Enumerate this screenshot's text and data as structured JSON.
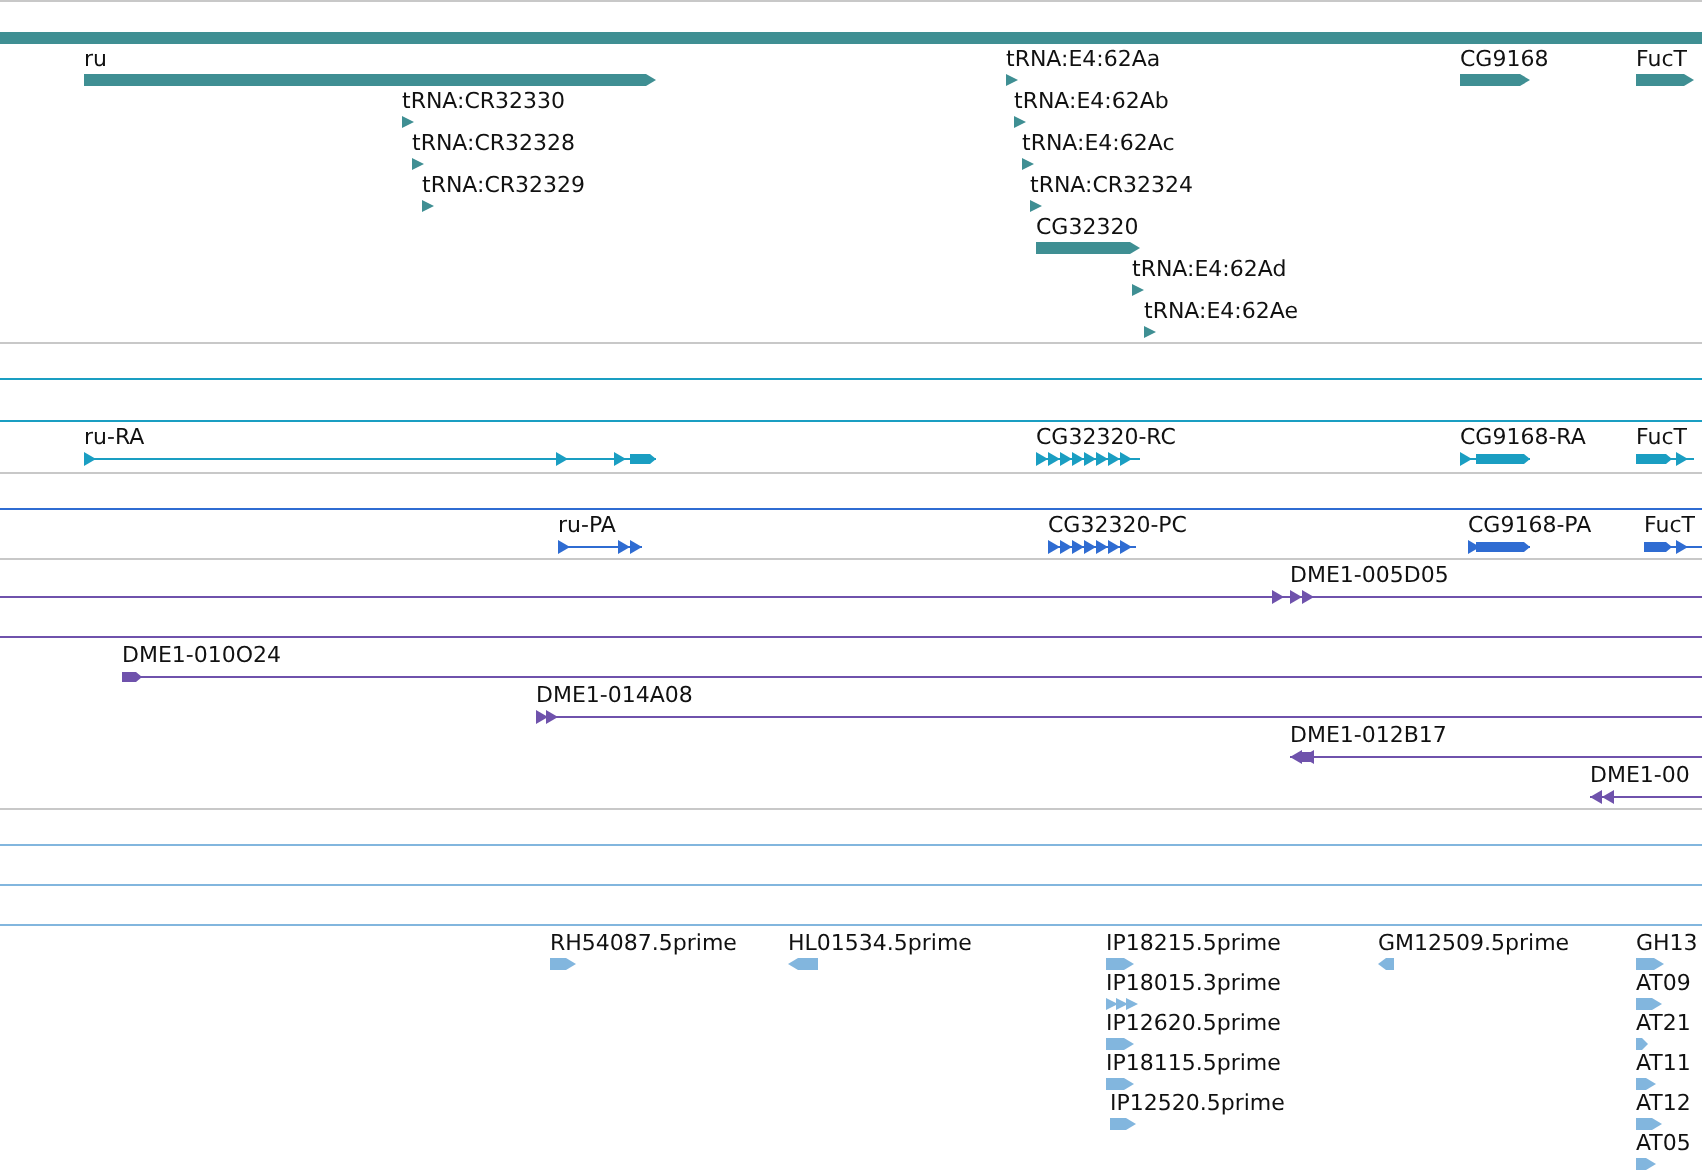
{
  "tracks": [
    {
      "color": "#3f8f93",
      "features": [
        {
          "label": "ru",
          "kind": "gene",
          "reverse": false
        },
        {
          "label": "tRNA:CR32330",
          "kind": "tick",
          "reverse": false
        },
        {
          "label": "tRNA:CR32328",
          "kind": "tick",
          "reverse": false
        },
        {
          "label": "tRNA:CR32329",
          "kind": "tick",
          "reverse": false
        },
        {
          "label": "tRNA:E4:62Aa",
          "kind": "tick",
          "reverse": false
        },
        {
          "label": "tRNA:E4:62Ab",
          "kind": "tick",
          "reverse": false
        },
        {
          "label": "tRNA:E4:62Ac",
          "kind": "tick",
          "reverse": false
        },
        {
          "label": "tRNA:CR32324",
          "kind": "tick",
          "reverse": false
        },
        {
          "label": "CG32320",
          "kind": "gene",
          "reverse": false
        },
        {
          "label": "tRNA:E4:62Ad",
          "kind": "tick",
          "reverse": false
        },
        {
          "label": "tRNA:E4:62Ae",
          "kind": "tick",
          "reverse": false
        },
        {
          "label": "CG9168",
          "kind": "gene",
          "reverse": false
        },
        {
          "label": "FucT",
          "kind": "gene",
          "reverse": false
        }
      ]
    },
    {
      "color": "#1a9ec2",
      "features": [
        {
          "label": "ru-RA",
          "kind": "transcript",
          "reverse": false
        },
        {
          "label": "CG32320-RC",
          "kind": "transcript",
          "reverse": false
        },
        {
          "label": "CG9168-RA",
          "kind": "transcript",
          "reverse": false
        },
        {
          "label": "FucT",
          "kind": "transcript",
          "reverse": false
        }
      ]
    },
    {
      "color": "#2f6cd2",
      "features": [
        {
          "label": "ru-PA",
          "kind": "transcript",
          "reverse": false
        },
        {
          "label": "CG32320-PC",
          "kind": "transcript",
          "reverse": false
        },
        {
          "label": "CG9168-PA",
          "kind": "transcript",
          "reverse": false
        },
        {
          "label": "FucT",
          "kind": "transcript",
          "reverse": false
        }
      ]
    },
    {
      "color": "#6f52ac",
      "features": [
        {
          "label": "DME1-005D05",
          "kind": "clone",
          "reverse": false
        },
        {
          "kind": "clone"
        },
        {
          "label": "DME1-010O24",
          "kind": "clone",
          "reverse": false
        },
        {
          "label": "DME1-014A08",
          "kind": "clone",
          "reverse": false
        },
        {
          "label": "DME1-012B17",
          "kind": "clone",
          "reverse": true
        },
        {
          "label": "DME1-00",
          "kind": "clone",
          "reverse": true
        }
      ]
    },
    {
      "color": "#82b6de",
      "features": [
        {
          "label": "RH54087.5prime",
          "kind": "est",
          "reverse": false
        },
        {
          "label": "HL01534.5prime",
          "kind": "est",
          "reverse": true
        },
        {
          "label": "IP18215.5prime",
          "kind": "est",
          "reverse": false
        },
        {
          "label": "IP18015.3prime",
          "kind": "est",
          "reverse": false
        },
        {
          "label": "IP12620.5prime",
          "kind": "est",
          "reverse": false
        },
        {
          "label": "IP18115.5prime",
          "kind": "est",
          "reverse": false
        },
        {
          "label": "IP12520.5prime",
          "kind": "est",
          "reverse": false
        },
        {
          "label": "GM12509.5prime",
          "kind": "est",
          "reverse": true
        },
        {
          "label": "GH13",
          "kind": "est",
          "reverse": false
        },
        {
          "label": "AT09",
          "kind": "est",
          "reverse": false
        },
        {
          "label": "AT21",
          "kind": "est",
          "reverse": false
        },
        {
          "label": "AT11",
          "kind": "est",
          "reverse": false
        },
        {
          "label": "AT12",
          "kind": "est",
          "reverse": false
        },
        {
          "label": "AT05",
          "kind": "est",
          "reverse": false
        }
      ]
    }
  ]
}
